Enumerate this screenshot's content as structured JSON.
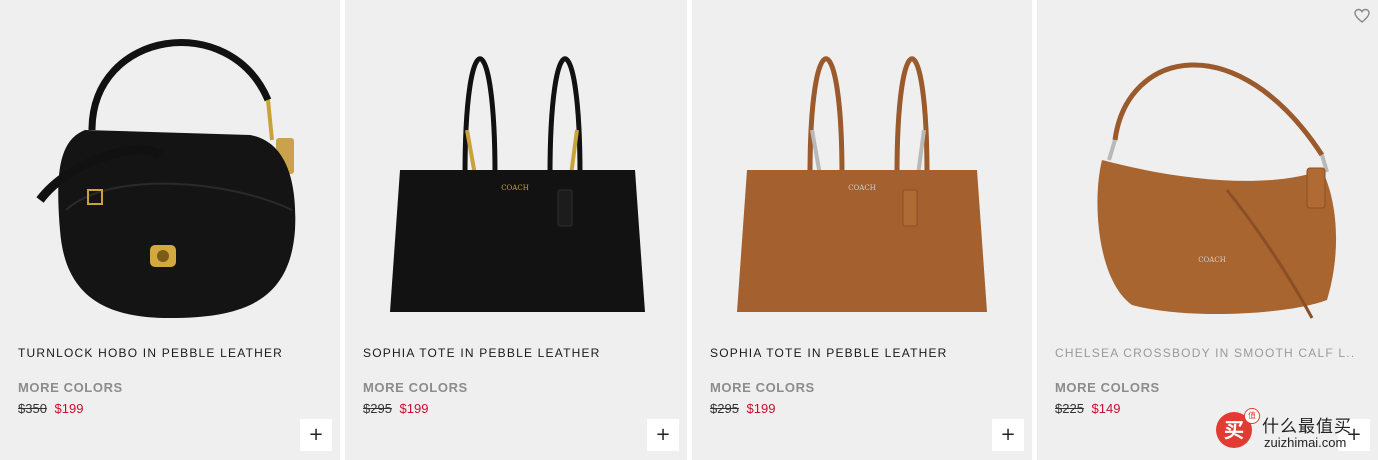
{
  "products": [
    {
      "title": "TURNLOCK HOBO IN PEBBLE LEATHER",
      "more_colors": "MORE COLORS",
      "price_original": "$350",
      "price_sale": "$199",
      "add_label": "+",
      "bag_color": "#0f0f0f",
      "hardware_color": "#c9a23a"
    },
    {
      "title": "SOPHIA TOTE IN PEBBLE LEATHER",
      "more_colors": "MORE COLORS",
      "price_original": "$295",
      "price_sale": "$199",
      "add_label": "+",
      "bag_color": "#0f0f0f",
      "hardware_color": "#c9a23a"
    },
    {
      "title": "SOPHIA TOTE IN PEBBLE LEATHER",
      "more_colors": "MORE COLORS",
      "price_original": "$295",
      "price_sale": "$199",
      "add_label": "+",
      "bag_color": "#a4602f",
      "hardware_color": "#b8b8b8"
    },
    {
      "title": "CHELSEA CROSSBODY IN SMOOTH CALF L...",
      "more_colors": "MORE COLORS",
      "price_original": "$225",
      "price_sale": "$149",
      "add_label": "+",
      "bag_color": "#a9652f",
      "hardware_color": "#b8b8b8",
      "wishlist_icon": "heart-outline-icon"
    }
  ],
  "colors": {
    "card_bg": "#efefef",
    "sale_red": "#c8102e",
    "muted_gray": "#8c8c8c"
  },
  "watermark": {
    "logo_glyph": "买",
    "badge_glyph": "值",
    "text_cn": "什么最值买",
    "text_en": "zuizhimai.com"
  }
}
